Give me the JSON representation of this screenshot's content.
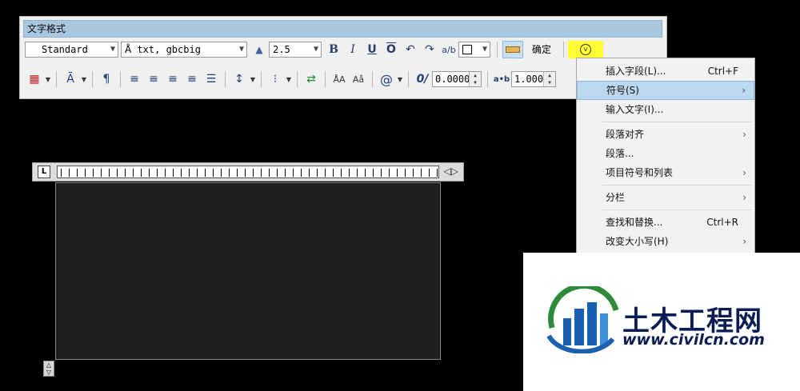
{
  "toolbar": {
    "title": "文字格式",
    "style_value": "Standard",
    "font_value": "txt, gbcbig",
    "height_value": "2.5",
    "ok_label": "确定",
    "oblique_value": "0.0000",
    "tracking_value": "1.0000",
    "stack_label": "ÅA",
    "stack_label2": "Aå"
  },
  "ruler": {
    "tab_label": "L"
  },
  "context_menu": {
    "items": [
      {
        "label": "插入字段(L)...",
        "shortcut": "Ctrl+F",
        "submenu": false
      },
      {
        "label": "符号(S)",
        "shortcut": "",
        "submenu": true,
        "highlighted": true
      },
      {
        "label": "输入文字(I)...",
        "shortcut": "",
        "submenu": false
      },
      {
        "label": "段落对齐",
        "shortcut": "",
        "submenu": true
      },
      {
        "label": "段落...",
        "shortcut": "",
        "submenu": false
      },
      {
        "label": "项目符号和列表",
        "shortcut": "",
        "submenu": true
      },
      {
        "label": "分栏",
        "shortcut": "",
        "submenu": true
      },
      {
        "label": "查找和替换...",
        "shortcut": "Ctrl+R",
        "submenu": false
      },
      {
        "label": "改变大小写(H)",
        "shortcut": "",
        "submenu": true
      }
    ]
  },
  "watermark": {
    "title": "土木工程网",
    "url": "www.civilcn.com"
  },
  "colors": {
    "title_bar": "#aac7e0",
    "highlight": "#bcd7f0",
    "options_button": "#ffff33",
    "editor_bg": "#1e1e1e",
    "watermark_text": "#0a1c54"
  }
}
